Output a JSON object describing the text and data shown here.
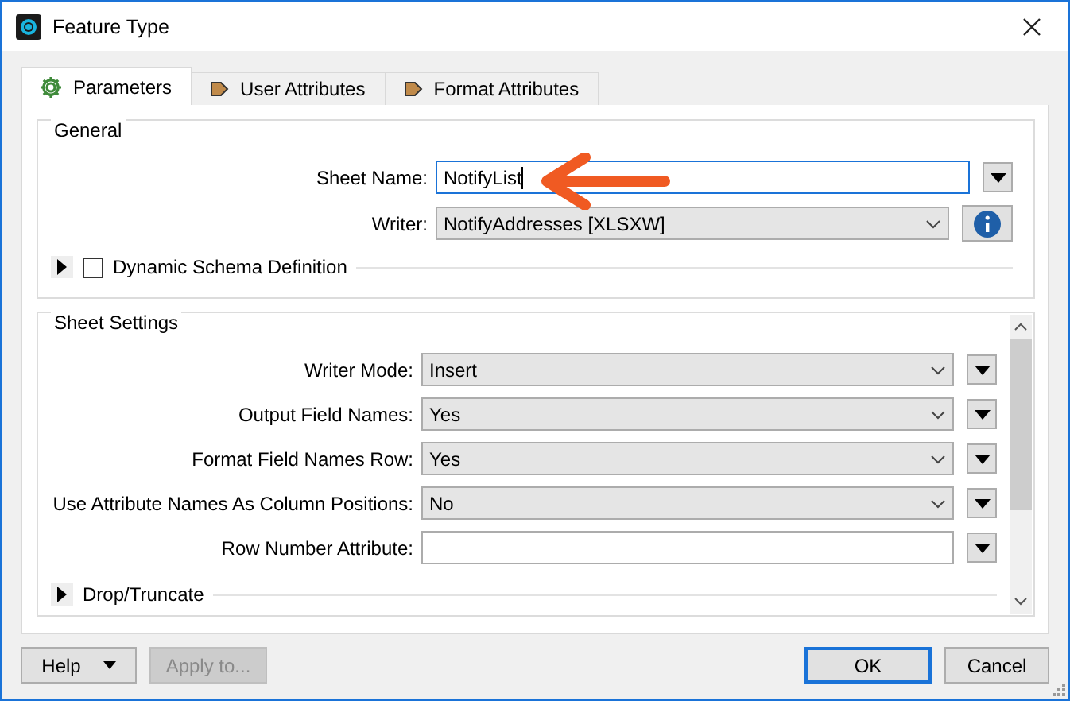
{
  "window": {
    "title": "Feature Type"
  },
  "tabs": [
    {
      "label": "Parameters",
      "kind": "gear",
      "selected": true
    },
    {
      "label": "User Attributes",
      "kind": "attribute",
      "selected": false
    },
    {
      "label": "Format Attributes",
      "kind": "attribute",
      "selected": false
    }
  ],
  "general": {
    "title": "General",
    "fields": [
      {
        "label": "Sheet Name:",
        "kind": "text",
        "value": "NotifyList",
        "focused": true,
        "button": {
          "kind": "menu"
        }
      },
      {
        "label": "Writer:",
        "kind": "select",
        "value": "NotifyAddresses [XLSXW]",
        "focused": false,
        "button": {
          "kind": "info"
        }
      }
    ],
    "section": {
      "label": "Dynamic Schema Definition",
      "kind": "checkbox",
      "checked": false,
      "expanded": false
    }
  },
  "sheet_settings": {
    "title": "Sheet Settings",
    "fields": [
      {
        "label": "Writer Mode:",
        "kind": "select",
        "value": "Insert",
        "focused": false,
        "button": {
          "kind": "menu"
        }
      },
      {
        "label": "Output Field Names:",
        "kind": "select",
        "value": "Yes",
        "focused": false,
        "button": {
          "kind": "menu"
        }
      },
      {
        "label": "Format Field Names Row:",
        "kind": "select",
        "value": "Yes",
        "focused": false,
        "button": {
          "kind": "menu"
        }
      },
      {
        "label": "Use Attribute Names As Column Positions:",
        "kind": "select",
        "value": "No",
        "focused": false,
        "button": {
          "kind": "menu"
        }
      },
      {
        "label": "Row Number Attribute:",
        "kind": "text",
        "focused": false,
        "button": {
          "kind": "menu"
        }
      }
    ],
    "section": {
      "label": "Drop/Truncate",
      "expanded": false
    }
  },
  "buttons": [
    {
      "label": "Help",
      "kind": "split",
      "default": false,
      "disabled": false
    },
    {
      "label": "Apply to...",
      "kind": "plain",
      "default": false,
      "disabled": true
    },
    {
      "label": "OK",
      "kind": "plain",
      "default": true,
      "disabled": false
    },
    {
      "label": "Cancel",
      "kind": "plain",
      "default": false,
      "disabled": false
    }
  ]
}
